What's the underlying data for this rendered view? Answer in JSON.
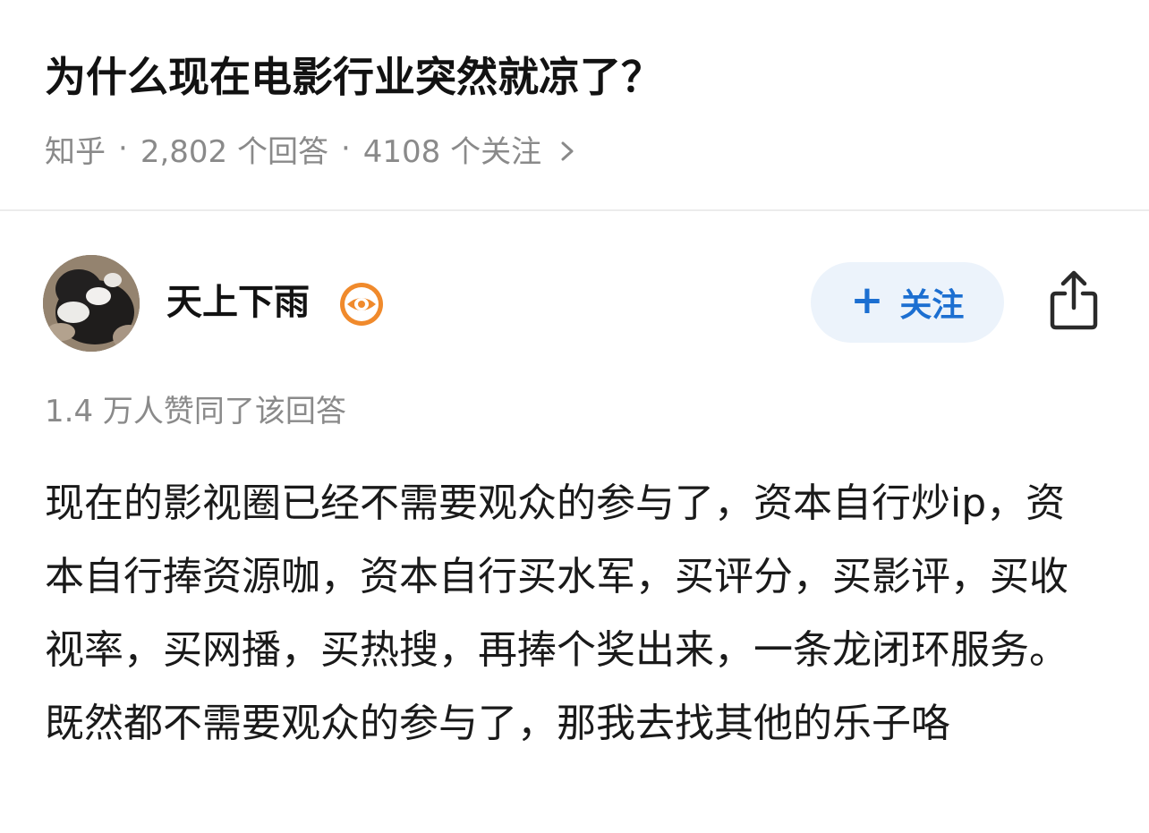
{
  "question": {
    "title": "为什么现在电影行业突然就凉了？",
    "source": "知乎",
    "answers": "2,802 个回答",
    "followers": "4108 个关注",
    "separator": "·"
  },
  "author": {
    "name": "天上下雨",
    "avatar_icon": "cat-avatar",
    "badge_icon": "eye-badge-icon"
  },
  "actions": {
    "follow_plus": "+",
    "follow_label": "关注",
    "share_icon": "share-icon"
  },
  "answer": {
    "votes": "1.4 万人赞同了该回答",
    "body": "现在的影视圈已经不需要观众的参与了，资本自行炒ip，资本自行捧资源咖，资本自行买水军，买评分，买影评，买收视率，买网播，买热搜，再捧个奖出来，一条龙闭环服务。既然都不需要观众的参与了，那我去找其他的乐子咯"
  },
  "colors": {
    "accent": "#1c6fd1",
    "follow_bg": "#ecf3fb",
    "meta_text": "#8a8a8a",
    "badge_orange": "#f08a2c"
  }
}
